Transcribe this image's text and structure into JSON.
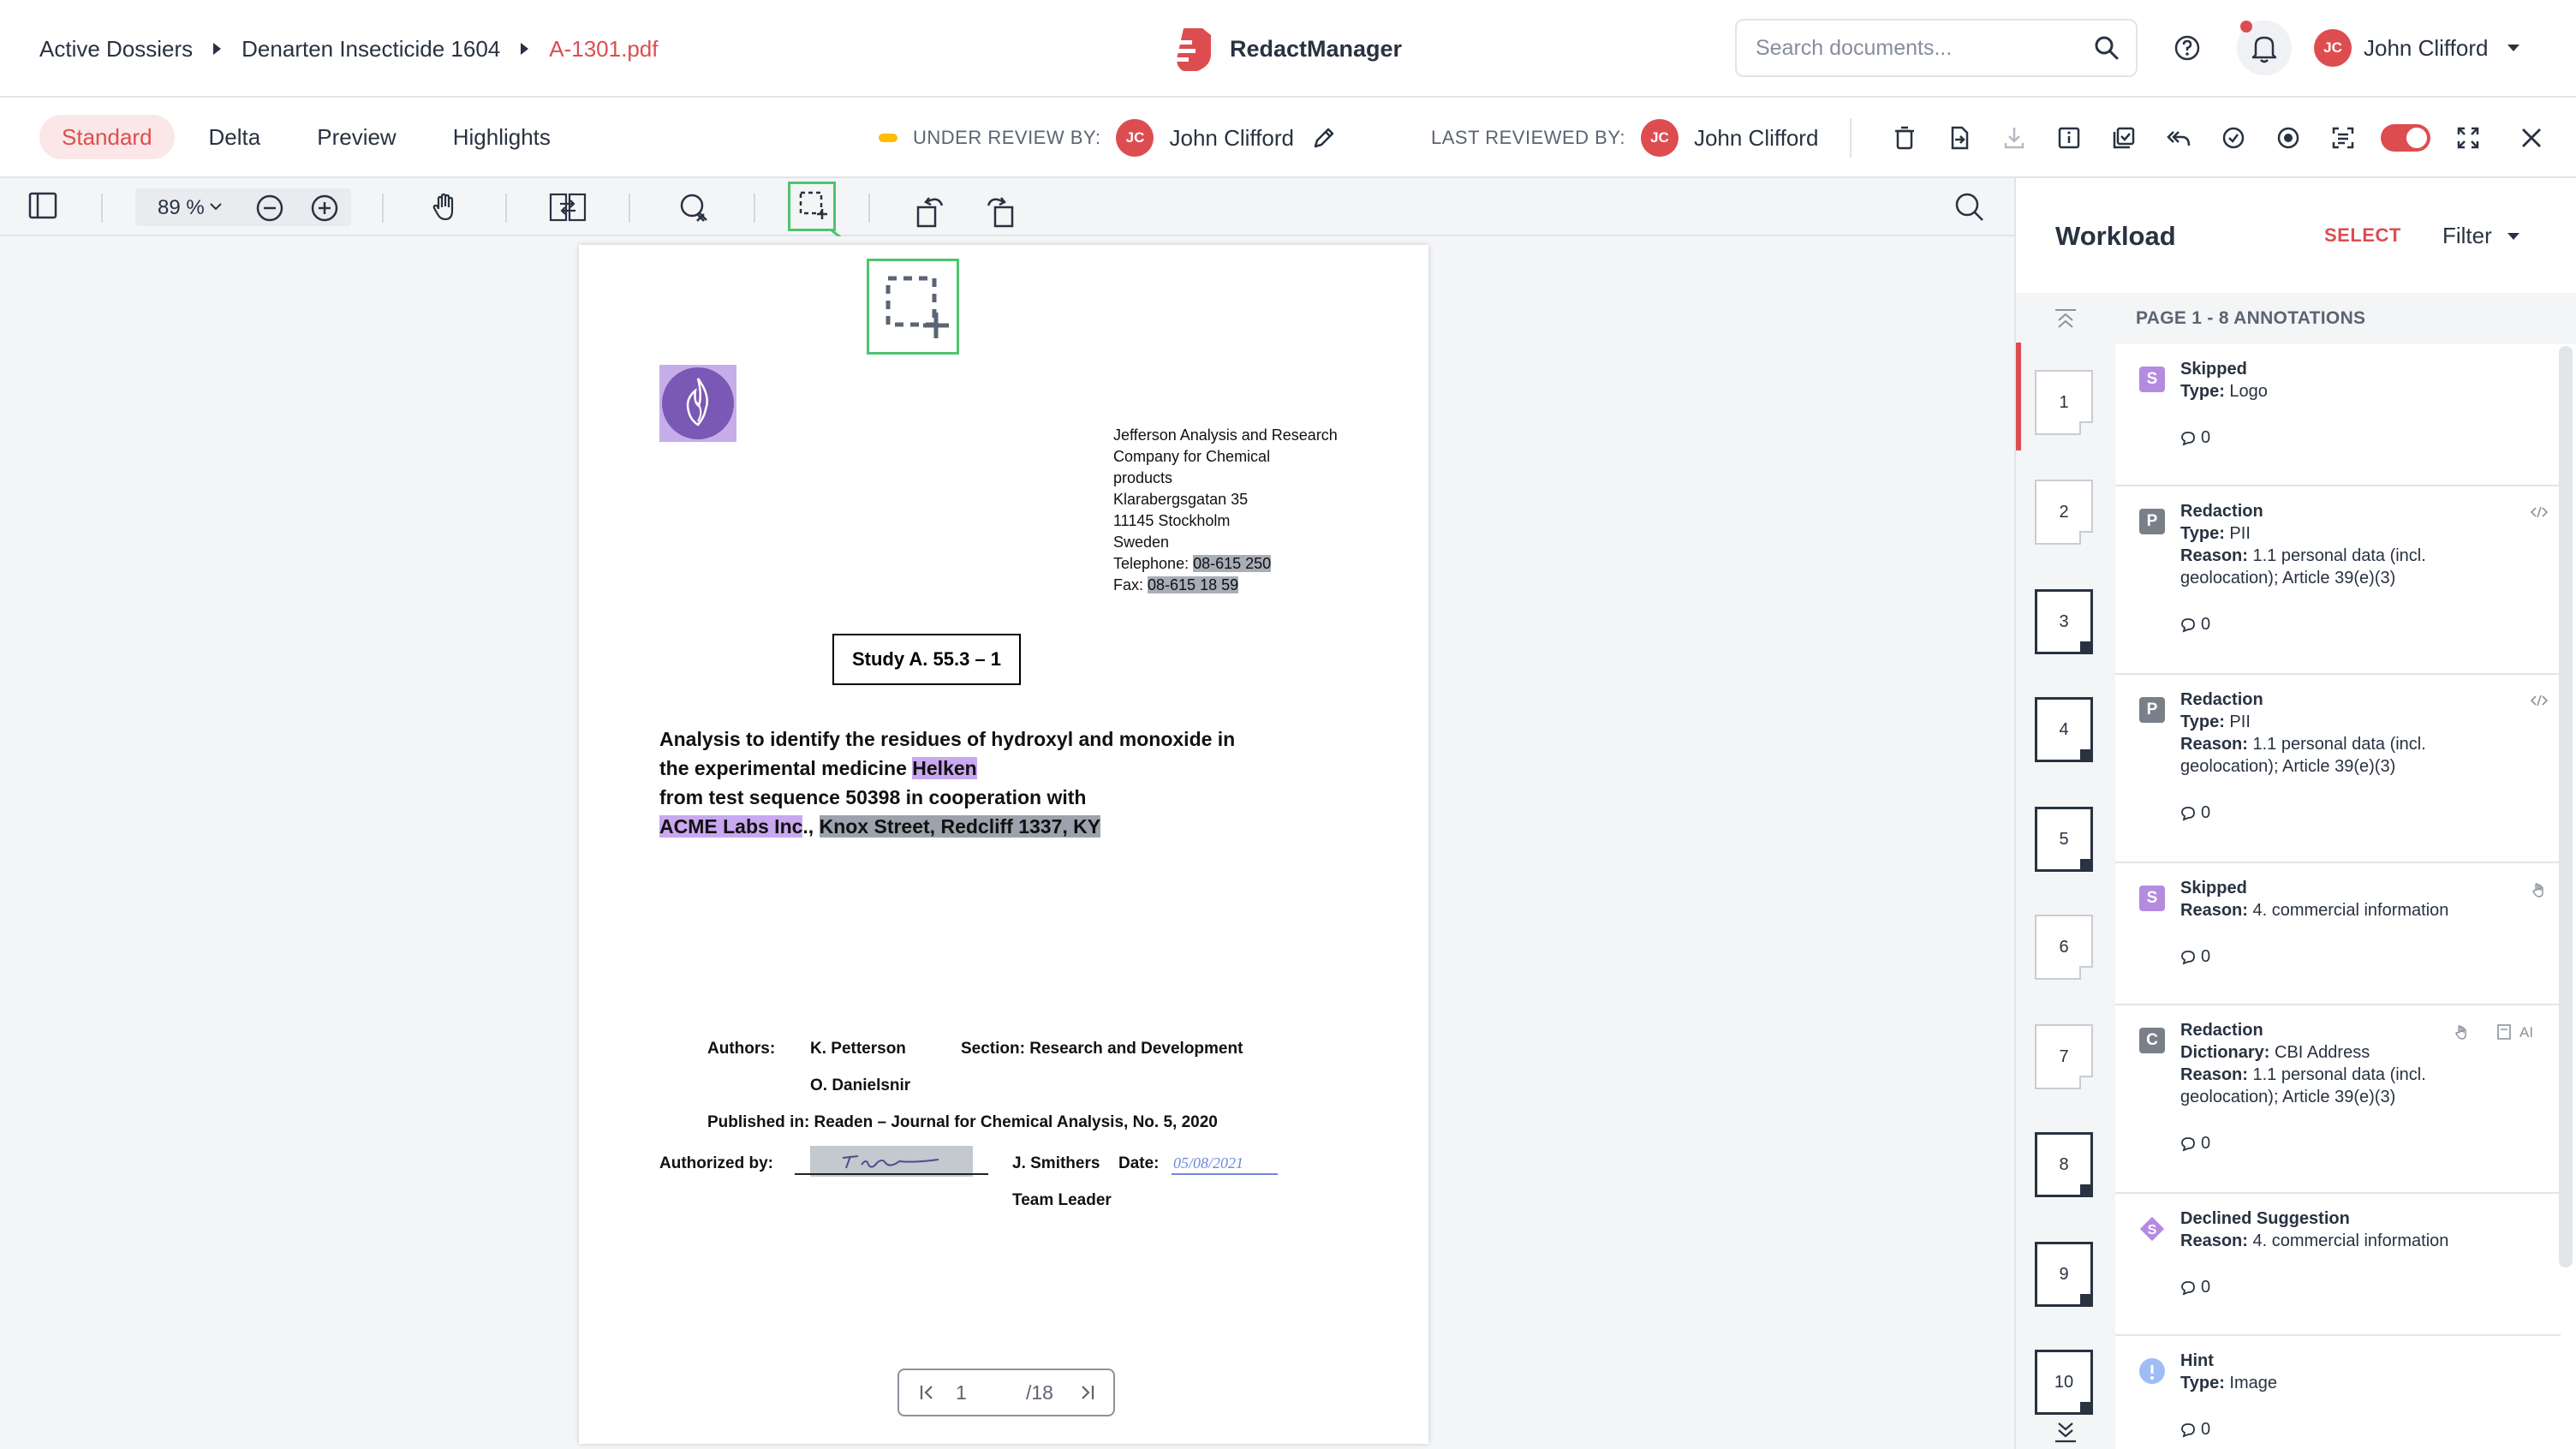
{
  "breadcrumb": {
    "items": [
      "Active Dossiers",
      "Denarten Insecticide 1604"
    ],
    "current_file": "A-1301.pdf"
  },
  "brand": {
    "name": "RedactManager",
    "color": "#dd4d50"
  },
  "search": {
    "placeholder": "Search documents..."
  },
  "user": {
    "initials": "JC",
    "name": "John Clifford"
  },
  "tabs": [
    {
      "label": "Standard",
      "active": true
    },
    {
      "label": "Delta",
      "active": false
    },
    {
      "label": "Preview",
      "active": false
    },
    {
      "label": "Highlights",
      "active": false
    }
  ],
  "review": {
    "under_review_label": "UNDER REVIEW BY:",
    "under_review_initials": "JC",
    "under_review_name": "John Clifford",
    "last_reviewed_label": "LAST REVIEWED BY:",
    "last_reviewed_initials": "JC",
    "last_reviewed_name": "John Clifford"
  },
  "viewer": {
    "zoom": "89 %"
  },
  "document": {
    "address_lines": [
      "Jefferson Analysis and Research",
      "Company for Chemical",
      "products",
      "Klarabergsgatan 35",
      "11145 Stockholm",
      "Sweden"
    ],
    "telephone_label": "Telephone: ",
    "telephone": "08-615 250",
    "fax_label": "Fax: ",
    "fax": "08-615 18 59",
    "study": "Study A. 55.3 – 1",
    "heading_line1": "Analysis to identify the residues of hydroxyl and monoxide in",
    "heading_line2_pre": "the experimental medicine ",
    "heading_line2_mark": "Helken",
    "heading_line3": "from test sequence 50398 in cooperation with",
    "heading_line4_mark1": "ACME Labs Inc",
    "heading_line4_mid": "., ",
    "heading_line4_mark2": "Knox Street, Redcliff 1337, KY",
    "authors_label": "Authors:",
    "author1": "K. Petterson",
    "author2": "O. Danielsnir",
    "section": "Section: Research and Development",
    "published": "Published in: Readen – Journal for Chemical Analysis, No. 5, 2020",
    "authorized_label": "Authorized by:",
    "signer": "J. Smithers",
    "date_label": "Date:",
    "date_value": "05/08/2021",
    "signer_role": "Team Leader",
    "page_current": "1",
    "page_total": "/18"
  },
  "workload": {
    "title": "Workload",
    "select": "SELECT",
    "filter": "Filter",
    "page_header": "PAGE 1 - 8 ANNOTATIONS",
    "pages": [
      "1",
      "2",
      "3",
      "4",
      "5",
      "6",
      "7",
      "8",
      "9",
      "10"
    ],
    "annotations": [
      {
        "badge": "S",
        "title": "Skipped",
        "k1": "Type:",
        "v1": " Logo",
        "k2": "",
        "v2": "",
        "count": "0",
        "color": "#b58be0"
      },
      {
        "badge": "P",
        "title": "Redaction",
        "k1": "Type:",
        "v1": " PII",
        "k2": "Reason:",
        "v2": " 1.1 personal data (incl. geolocation); Article 39(e)(3)",
        "count": "0",
        "color": "#7a8089"
      },
      {
        "badge": "P",
        "title": "Redaction",
        "k1": "Type:",
        "v1": " PII",
        "k2": "Reason:",
        "v2": " 1.1 personal data (incl. geolocation); Article 39(e)(3)",
        "count": "0",
        "color": "#7a8089"
      },
      {
        "badge": "S",
        "title": "Skipped",
        "k1": "Reason:",
        "v1": " 4. commercial information",
        "k2": "",
        "v2": "",
        "count": "0",
        "color": "#b58be0"
      },
      {
        "badge": "C",
        "title": "Redaction",
        "k1": "Dictionary:",
        "v1": " CBI Address",
        "k2": "Reason:",
        "v2": " 1.1 personal data (incl. geolocation); Article 39(e)(3)",
        "count": "0",
        "color": "#7a8089",
        "ai": "AI"
      },
      {
        "badge": "S",
        "title": "Declined Suggestion",
        "k1": "Reason:",
        "v1": " 4. commercial information",
        "k2": "",
        "v2": "",
        "count": "0",
        "color": "#b58be0"
      },
      {
        "badge": "i",
        "title": "Hint",
        "k1": "Type:",
        "v1": " Image",
        "k2": "",
        "v2": "",
        "count": "0",
        "color": "#9fbdf5"
      }
    ]
  }
}
